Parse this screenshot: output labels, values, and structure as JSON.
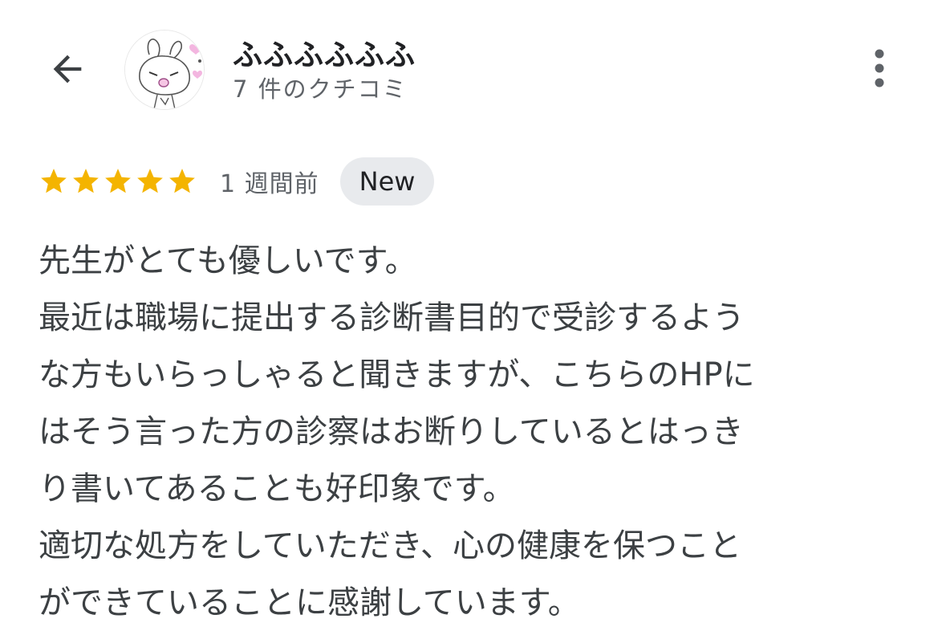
{
  "header": {
    "user_name": "ふふふふふふ",
    "review_count": "7 件のクチコミ",
    "back_icon": "arrow-back-icon",
    "more_icon": "more-vert-icon"
  },
  "review": {
    "rating": 5,
    "rating_max": 5,
    "star_color": "#f4b400",
    "time_ago": "1 週間前",
    "badge": "New",
    "lines": [
      "先生がとても優しいです。",
      "最近は職場に提出する診断書目的で受診するよう",
      "な方もいらっしゃると聞きますが、こちらのHPに",
      "はそう言った方の診察はお断りしているとはっき",
      "り書いてあることも好印象です。",
      "適切な処方をしていただき、心の健康を保つこと",
      "ができていることに感謝しています。"
    ]
  }
}
